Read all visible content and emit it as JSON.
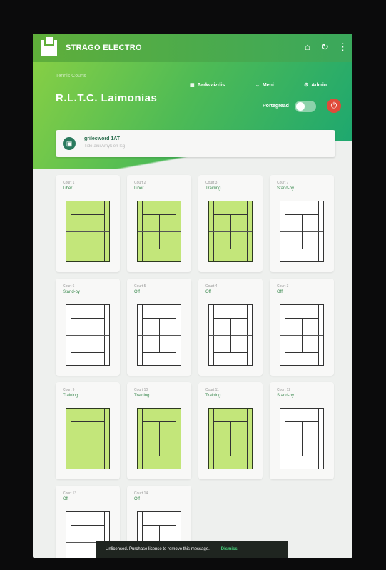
{
  "app": {
    "brand": "STRAGO ELECTRO"
  },
  "topbar": {
    "home_icon": "home-icon",
    "refresh_icon": "refresh-icon",
    "menu_icon": "more-vert-icon"
  },
  "header": {
    "breadcrumb": "Tennis Courts",
    "club_name": "R.L.T.C. Laimonias",
    "nav": [
      {
        "icon": "grid-icon",
        "label": "Parkvaizdis"
      },
      {
        "icon": "chevron-down-icon",
        "label": "Meni"
      },
      {
        "icon": "gear-icon",
        "label": "Admin"
      }
    ],
    "toggle_label": "Portegread",
    "power_icon": "power-icon"
  },
  "alert": {
    "title": "grilecword 1AT",
    "subtitle": "Tide-aiui Amyk en-lsg"
  },
  "courts": [
    {
      "number": "Court 1",
      "status": "Liber",
      "active": true
    },
    {
      "number": "Court 2",
      "status": "Liber",
      "active": true
    },
    {
      "number": "Court 3",
      "status": "Training",
      "active": true
    },
    {
      "number": "Court 7",
      "status": "Stand-by",
      "active": false
    },
    {
      "number": "Court 6",
      "status": "Stand-by",
      "active": false
    },
    {
      "number": "Court 5",
      "status": "Off",
      "active": false
    },
    {
      "number": "Court 4",
      "status": "Off",
      "active": false
    },
    {
      "number": "Court 3",
      "status": "Off",
      "active": false
    },
    {
      "number": "Court 9",
      "status": "Training",
      "active": true
    },
    {
      "number": "Court 10",
      "status": "Training",
      "active": true
    },
    {
      "number": "Court 11",
      "status": "Training",
      "active": true
    },
    {
      "number": "Court 12",
      "status": "Stand-by",
      "active": false
    },
    {
      "number": "Court 13",
      "status": "Off",
      "active": false
    },
    {
      "number": "Court 14",
      "status": "Off",
      "active": false
    }
  ],
  "toast": {
    "message": "Unlicensed. Purchase license to remove this message.",
    "action": "Dismiss"
  }
}
